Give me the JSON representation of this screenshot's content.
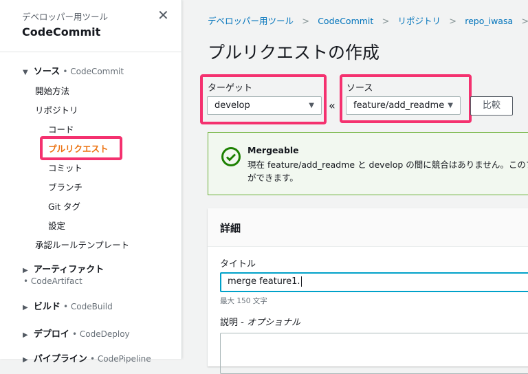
{
  "sidebar": {
    "category": "デベロッパー用ツール",
    "title": "CodeCommit",
    "sections": [
      {
        "label": "ソース",
        "service": "• CodeCommit",
        "expanded": true
      },
      {
        "label": "アーティファクト",
        "service": "• CodeArtifact"
      },
      {
        "label": "ビルド",
        "service": "• CodeBuild"
      },
      {
        "label": "デプロイ",
        "service": "• CodeDeploy"
      },
      {
        "label": "パイプライン",
        "service": "• CodePipeline"
      }
    ],
    "items": {
      "getting_started": "開始方法",
      "repositories": "リポジトリ",
      "code": "コード",
      "pull_requests": "プルリクエスト",
      "commits": "コミット",
      "branches": "ブランチ",
      "git_tags": "Git タグ",
      "settings": "設定",
      "approval_templates": "承認ルールテンプレート"
    }
  },
  "breadcrumb": [
    "デベロッパー用ツール",
    "CodeCommit",
    "リポジトリ",
    "repo_iwasa"
  ],
  "page_title": "プルリクエストの作成",
  "target": {
    "label": "ターゲット",
    "value": "develop"
  },
  "source": {
    "label": "ソース",
    "value": "feature/add_readme"
  },
  "arrow": "«",
  "compare_label": "比較",
  "alert": {
    "title": "Mergeable",
    "line1": "現在 feature/add_readme と develop の間に競合はありません。このプ",
    "line2": "ができます。"
  },
  "details": {
    "heading": "詳細",
    "title_label": "タイトル",
    "title_value": "merge feature1.",
    "title_hint": "最大 150 文字",
    "desc_label": "説明 - ",
    "desc_optional": "オプショナル",
    "desc_value": ""
  },
  "colors": {
    "highlight": "#f4316f",
    "active": "#ec7211",
    "link": "#0073bb",
    "success": "#1d8102"
  }
}
